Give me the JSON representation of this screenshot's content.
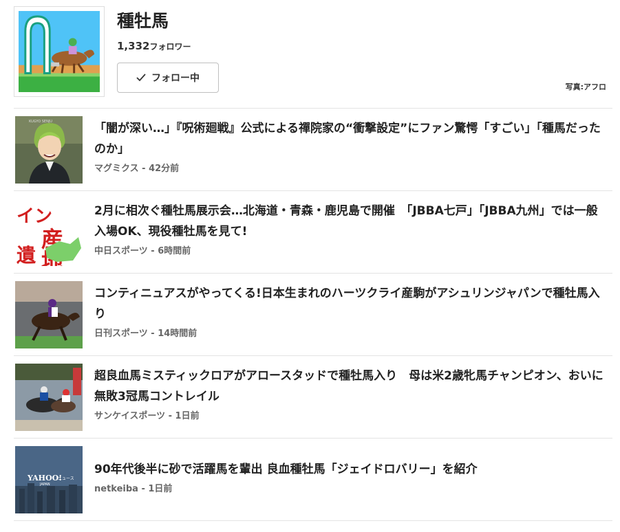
{
  "topic": {
    "title": "種牡馬",
    "followers_count": "1,332",
    "followers_unit": "フォロワー",
    "follow_button_label": "フォロー中",
    "photo_credit": "写真:アフロ"
  },
  "articles": [
    {
      "title": "「闇が深い…」『呪術廻戦』公式による禪院家の“衝撃設定”にファン驚愕「すごい」「種馬だったのか」",
      "source": "マグミクス",
      "time": "42分前"
    },
    {
      "title": "2月に相次ぐ種牡馬展示会…北海道・青森・鹿児島で開催　「JBBA七戸」「JBBA九州」では一般入場OK、現役種牡馬を見て!",
      "source": "中日スポーツ",
      "time": "6時間前"
    },
    {
      "title": "コンティニュアスがやってくる!日本生まれのハーツクライ産駒がアシュリンジャパンで種牡馬入り",
      "source": "日刊スポーツ",
      "time": "14時間前"
    },
    {
      "title": "超良血馬ミスティックロアがアロースタッドで種牡馬入り　母は米2歳牝馬チャンピオン、おいに無敗3冠馬コントレイル",
      "source": "サンケイスポーツ",
      "time": "1日前"
    },
    {
      "title": "90年代後半に砂で活躍馬を輩出 良血種牡馬「ジェイドロバリー」を紹介",
      "source": "netkeiba",
      "time": "1日前"
    }
  ],
  "images": {
    "anime_caption": "KUGYO SENJU",
    "newspaper_text_1": "産地",
    "newspaper_text_2": "イン",
    "newspaper_text_3": "遺",
    "yahoo_logo": "YAHOO!",
    "yahoo_sub": "JAPAN",
    "yahoo_news": "ニュース"
  },
  "colors": {
    "accent_green": "#3cb043",
    "sky": "#4fc3f7"
  }
}
